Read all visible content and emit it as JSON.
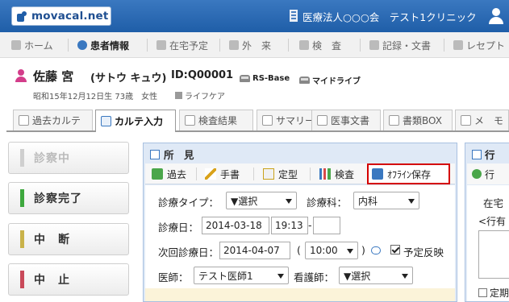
{
  "header": {
    "logo": "movacal.net",
    "facility": "医療法人○○○会　テスト1クリニック"
  },
  "nav": {
    "items": [
      {
        "label": "ホーム"
      },
      {
        "label": "患者情報"
      },
      {
        "label": "在宅予定"
      },
      {
        "label": "外　来"
      },
      {
        "label": "検　査"
      },
      {
        "label": "記録・文書"
      },
      {
        "label": "レセプト"
      }
    ]
  },
  "patient": {
    "name": "佐藤 宮",
    "kana": "(サトウ キュウ)",
    "id": "ID:Q00001",
    "links": [
      "RS-Base",
      "マイドライブ"
    ],
    "sub": "昭和15年12月12日生 73歳　女性",
    "life": "ライフケア"
  },
  "tabs": [
    {
      "label": "過去カルテ"
    },
    {
      "label": "カルテ入力"
    },
    {
      "label": "検査結果"
    },
    {
      "label": "サマリー"
    },
    {
      "label": "医事文書"
    },
    {
      "label": "書類BOX"
    },
    {
      "label": "メ　モ"
    }
  ],
  "status_buttons": [
    {
      "label": "診察中",
      "color": "#cfcfcf"
    },
    {
      "label": "診察完了",
      "color": "#3ea83e"
    },
    {
      "label": "中　断",
      "color": "#c9b24a"
    },
    {
      "label": "中　止",
      "color": "#c94a5a"
    }
  ],
  "findings": {
    "title": "所　見",
    "toolbar": [
      "過去",
      "手書",
      "定型",
      "検査",
      "ｵﾌﾗｲﾝ保存"
    ],
    "exam_type_label": "診療タイプ：",
    "exam_type_value": "▼選択",
    "department_label": "診療科：",
    "department_value": "内科",
    "date_label": "診療日：",
    "date_value": "2014-03-18",
    "time_value": "19:13",
    "time_end_value": "",
    "next_label": "次回診療日：",
    "next_value": "2014-04-07",
    "next_paren_open": "(",
    "next_time_value": "10:00",
    "next_paren_close": ")",
    "reflect_label": "予定反映",
    "doctor_label": "医師：",
    "doctor_value": "テスト医師1",
    "nurse_label": "看護師：",
    "nurse_value": "▼選択"
  },
  "right_panel": {
    "title": "行",
    "toolbar": "行",
    "text1": "在宅",
    "text2": "<行有",
    "check_label": "定期"
  },
  "colors": {
    "header": "#1f5ea8",
    "accent": "#3a78c0",
    "highlight_border": "#d40000"
  }
}
